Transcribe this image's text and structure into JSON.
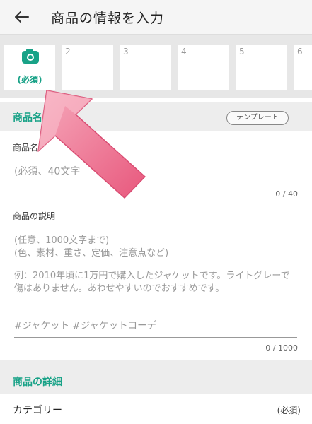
{
  "header": {
    "back_icon": "arrow-left-icon",
    "title": "商品の情報を入力"
  },
  "photos": {
    "camera_icon": "camera-icon",
    "main_label": "(必須)",
    "slots": [
      "2",
      "3",
      "4",
      "5",
      "6"
    ]
  },
  "section_name": {
    "title": "商品名",
    "template_button": "テンプレート"
  },
  "name_field": {
    "label": "商品名",
    "placeholder": "(必須、40文字",
    "counter": "0 / 40"
  },
  "desc_field": {
    "label": "商品の説明",
    "placeholder_line1": "(任意、1000文字まで)",
    "placeholder_line2": "(色、素材、重さ、定価、注意点など)",
    "example": "例：2010年頃に1万円で購入したジャケットです。ライトグレーで傷はありません。あわせやすいのでおすすめです。",
    "hashtags": "#ジャケット #ジャケットコーデ",
    "counter": "0 / 1000"
  },
  "section_details": {
    "title": "商品の詳細"
  },
  "category": {
    "label": "カテゴリー",
    "required": "(必須)"
  },
  "colors": {
    "accent": "#18a287",
    "arrow": "#ef7f9a"
  }
}
